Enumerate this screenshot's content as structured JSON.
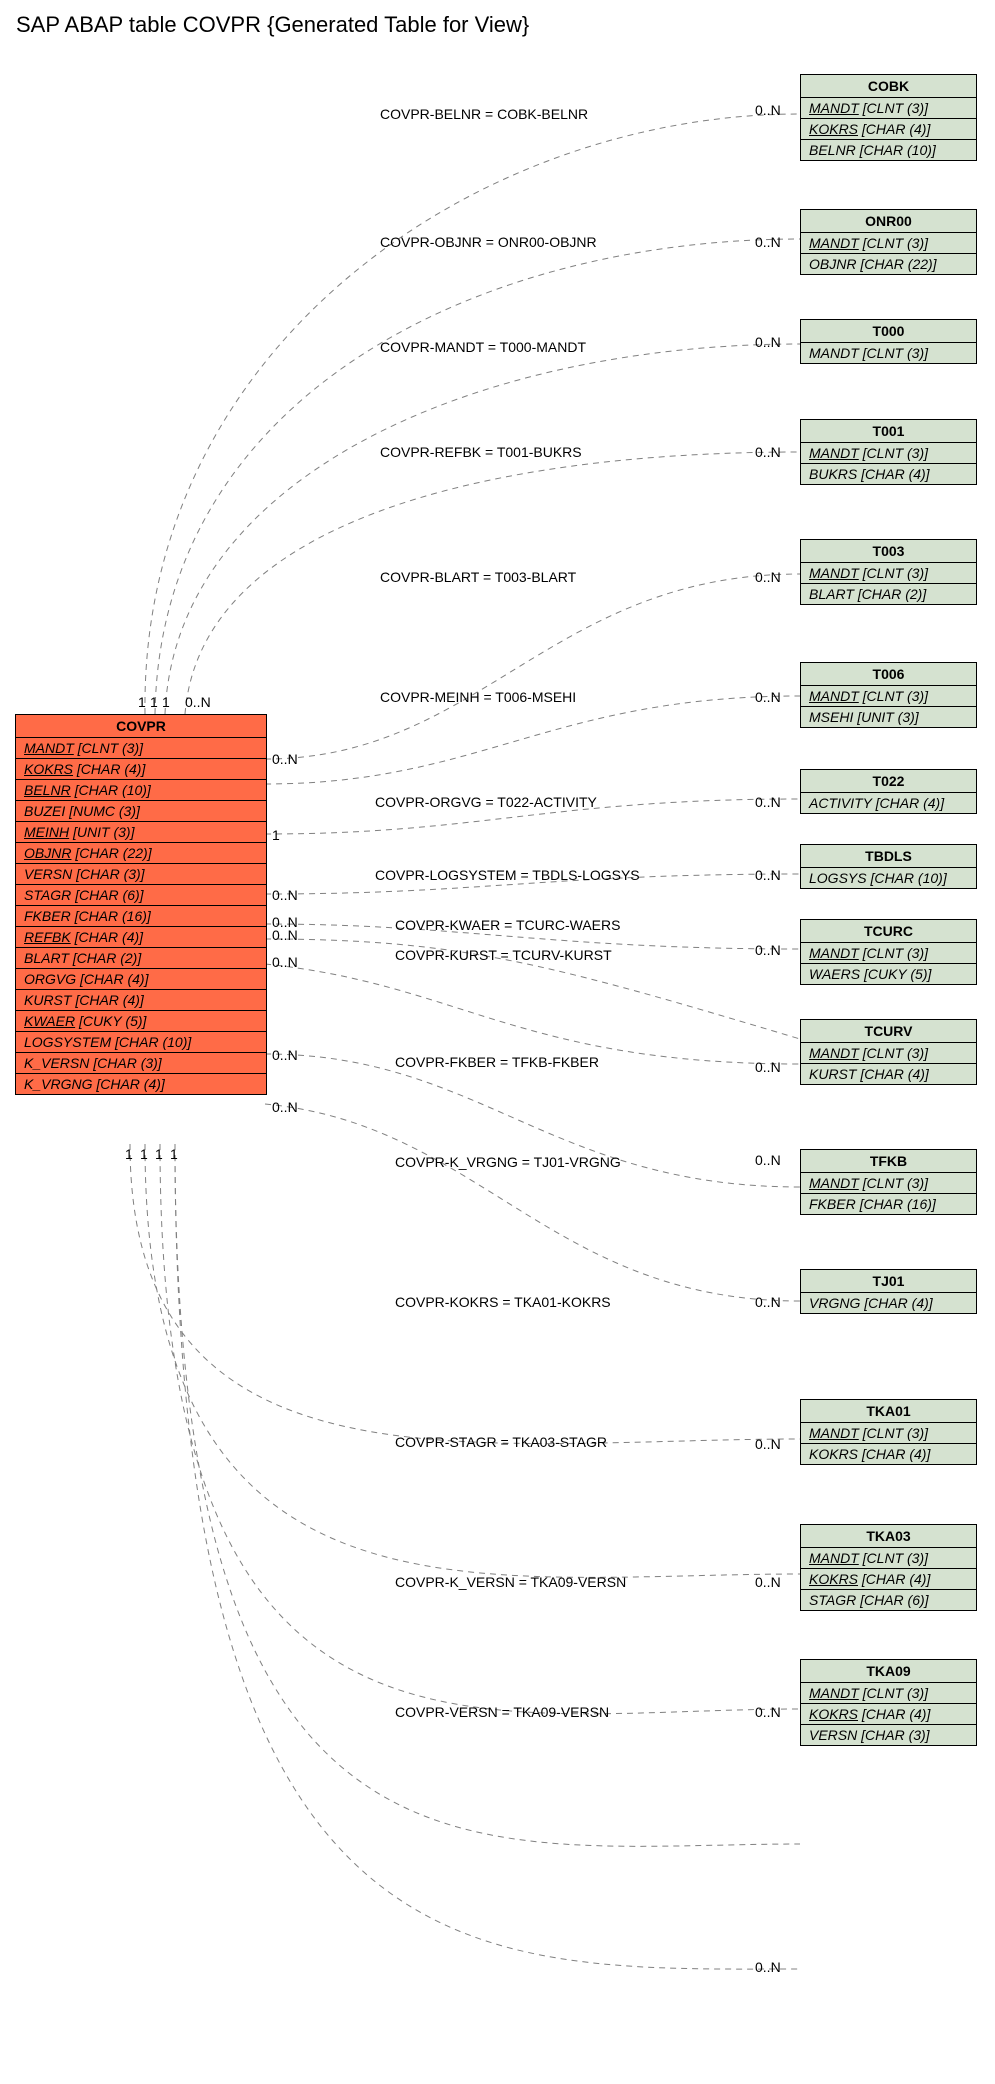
{
  "title": "SAP ABAP table COVPR {Generated Table for View}",
  "main": {
    "name": "COVPR",
    "fields": [
      {
        "k": true,
        "name": "MANDT",
        "type": "[CLNT (3)]"
      },
      {
        "k": true,
        "name": "KOKRS",
        "type": "[CHAR (4)]"
      },
      {
        "k": true,
        "name": "BELNR",
        "type": "[CHAR (10)]"
      },
      {
        "k": false,
        "name": "BUZEI",
        "type": "[NUMC (3)]"
      },
      {
        "k": true,
        "name": "MEINH",
        "type": "[UNIT (3)]"
      },
      {
        "k": true,
        "name": "OBJNR",
        "type": "[CHAR (22)]"
      },
      {
        "k": false,
        "name": "VERSN",
        "type": "[CHAR (3)]"
      },
      {
        "k": false,
        "name": "STAGR",
        "type": "[CHAR (6)]"
      },
      {
        "k": false,
        "name": "FKBER",
        "type": "[CHAR (16)]"
      },
      {
        "k": true,
        "name": "REFBK",
        "type": "[CHAR (4)]"
      },
      {
        "k": false,
        "name": "BLART",
        "type": "[CHAR (2)]"
      },
      {
        "k": false,
        "name": "ORGVG",
        "type": "[CHAR (4)]"
      },
      {
        "k": false,
        "name": "KURST",
        "type": "[CHAR (4)]"
      },
      {
        "k": true,
        "name": "KWAER",
        "type": "[CUKY (5)]"
      },
      {
        "k": false,
        "name": "LOGSYSTEM",
        "type": "[CHAR (10)]"
      },
      {
        "k": false,
        "name": "K_VERSN",
        "type": "[CHAR (3)]"
      },
      {
        "k": false,
        "name": "K_VRGNG",
        "type": "[CHAR (4)]"
      }
    ]
  },
  "related": [
    {
      "name": "COBK",
      "fields": [
        {
          "k": true,
          "name": "MANDT",
          "type": "[CLNT (3)]"
        },
        {
          "k": true,
          "name": "KOKRS",
          "type": "[CHAR (4)]"
        },
        {
          "k": false,
          "name": "BELNR",
          "type": "[CHAR (10)]"
        }
      ]
    },
    {
      "name": "ONR00",
      "fields": [
        {
          "k": true,
          "name": "MANDT",
          "type": "[CLNT (3)]"
        },
        {
          "k": false,
          "name": "OBJNR",
          "type": "[CHAR (22)]"
        }
      ]
    },
    {
      "name": "T000",
      "fields": [
        {
          "k": false,
          "name": "MANDT",
          "type": "[CLNT (3)]"
        }
      ]
    },
    {
      "name": "T001",
      "fields": [
        {
          "k": true,
          "name": "MANDT",
          "type": "[CLNT (3)]"
        },
        {
          "k": false,
          "name": "BUKRS",
          "type": "[CHAR (4)]"
        }
      ]
    },
    {
      "name": "T003",
      "fields": [
        {
          "k": true,
          "name": "MANDT",
          "type": "[CLNT (3)]"
        },
        {
          "k": false,
          "name": "BLART",
          "type": "[CHAR (2)]"
        }
      ]
    },
    {
      "name": "T006",
      "fields": [
        {
          "k": true,
          "name": "MANDT",
          "type": "[CLNT (3)]"
        },
        {
          "k": false,
          "name": "MSEHI",
          "type": "[UNIT (3)]"
        }
      ]
    },
    {
      "name": "T022",
      "fields": [
        {
          "k": false,
          "name": "ACTIVITY",
          "type": "[CHAR (4)]"
        }
      ]
    },
    {
      "name": "TBDLS",
      "fields": [
        {
          "k": false,
          "name": "LOGSYS",
          "type": "[CHAR (10)]"
        }
      ]
    },
    {
      "name": "TCURC",
      "fields": [
        {
          "k": true,
          "name": "MANDT",
          "type": "[CLNT (3)]"
        },
        {
          "k": false,
          "name": "WAERS",
          "type": "[CUKY (5)]"
        }
      ]
    },
    {
      "name": "TCURV",
      "fields": [
        {
          "k": true,
          "name": "MANDT",
          "type": "[CLNT (3)]"
        },
        {
          "k": false,
          "name": "KURST",
          "type": "[CHAR (4)]"
        }
      ]
    },
    {
      "name": "TFKB",
      "fields": [
        {
          "k": true,
          "name": "MANDT",
          "type": "[CLNT (3)]"
        },
        {
          "k": false,
          "name": "FKBER",
          "type": "[CHAR (16)]"
        }
      ]
    },
    {
      "name": "TJ01",
      "fields": [
        {
          "k": false,
          "name": "VRGNG",
          "type": "[CHAR (4)]"
        }
      ]
    },
    {
      "name": "TKA01",
      "fields": [
        {
          "k": true,
          "name": "MANDT",
          "type": "[CLNT (3)]"
        },
        {
          "k": false,
          "name": "KOKRS",
          "type": "[CHAR (4)]"
        }
      ]
    },
    {
      "name": "TKA03",
      "fields": [
        {
          "k": true,
          "name": "MANDT",
          "type": "[CLNT (3)]"
        },
        {
          "k": true,
          "name": "KOKRS",
          "type": "[CHAR (4)]"
        },
        {
          "k": false,
          "name": "STAGR",
          "type": "[CHAR (6)]"
        }
      ]
    },
    {
      "name": "TKA09",
      "fields": [
        {
          "k": true,
          "name": "MANDT",
          "type": "[CLNT (3)]"
        },
        {
          "k": true,
          "name": "KOKRS",
          "type": "[CHAR (4)]"
        },
        {
          "k": false,
          "name": "VERSN",
          "type": "[CHAR (3)]"
        }
      ]
    }
  ],
  "relations": [
    {
      "label": "COVPR-BELNR = COBK-BELNR",
      "cardR": "0..N"
    },
    {
      "label": "COVPR-OBJNR = ONR00-OBJNR",
      "cardR": "0..N"
    },
    {
      "label": "COVPR-MANDT = T000-MANDT",
      "cardR": "0..N"
    },
    {
      "label": "COVPR-REFBK = T001-BUKRS",
      "cardR": "0..N"
    },
    {
      "label": "COVPR-BLART = T003-BLART",
      "cardR": "0..N"
    },
    {
      "label": "COVPR-MEINH = T006-MSEHI",
      "cardR": "0..N"
    },
    {
      "label": "COVPR-ORGVG = T022-ACTIVITY",
      "cardR": "0..N"
    },
    {
      "label": "COVPR-LOGSYSTEM = TBDLS-LOGSYS",
      "cardR": "0..N"
    },
    {
      "label": "COVPR-KWAER = TCURC-WAERS",
      "cardR": "0..N"
    },
    {
      "label": "COVPR-KURST = TCURV-KURST",
      "cardR": ""
    },
    {
      "label": "COVPR-FKBER = TFKB-FKBER",
      "cardR": "0..N"
    },
    {
      "label": "COVPR-K_VRGNG = TJ01-VRGNG",
      "cardR": "0..N"
    },
    {
      "label": "COVPR-KOKRS = TKA01-KOKRS",
      "cardR": "0..N"
    },
    {
      "label": "COVPR-STAGR = TKA03-STAGR",
      "cardR": "0..N"
    },
    {
      "label": "COVPR-K_VERSN = TKA09-VERSN",
      "cardR": "0..N"
    },
    {
      "label": "COVPR-VERSN = TKA09-VERSN",
      "cardR": "0..N"
    }
  ],
  "mainCards": {
    "topRow": [
      "1",
      "1",
      "1",
      "0..N"
    ],
    "bottomRow": [
      "1",
      "1",
      "1",
      "1"
    ],
    "right": [
      "0..N",
      "1",
      "0..N",
      "0..N",
      "0..N",
      "0..N",
      "0..N",
      "0..N"
    ]
  }
}
